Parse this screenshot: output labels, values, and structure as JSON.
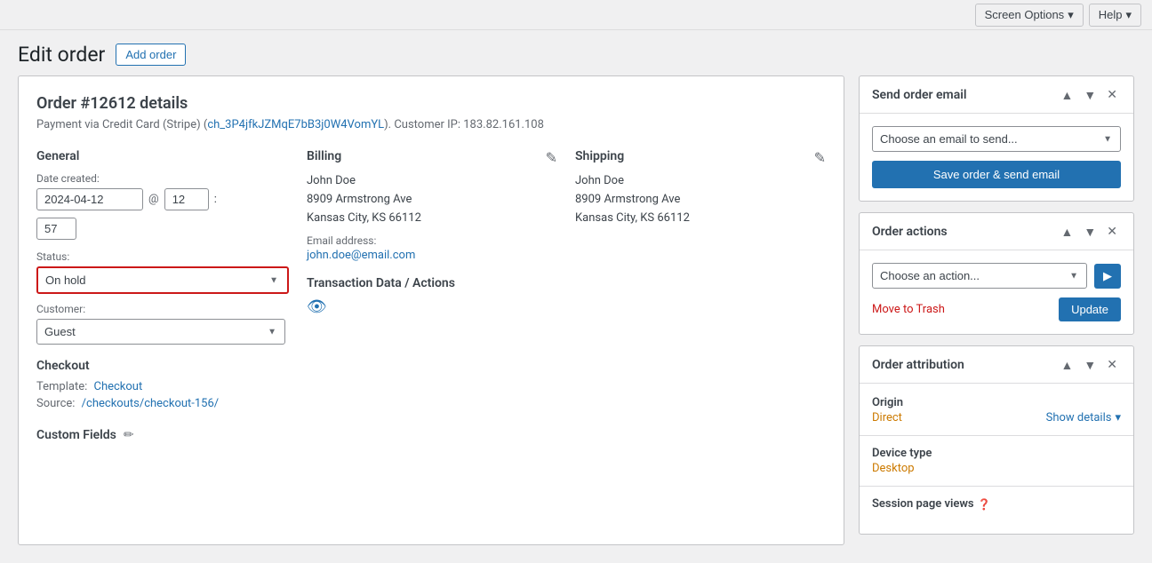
{
  "topbar": {
    "screen_options_label": "Screen Options",
    "help_label": "Help"
  },
  "header": {
    "page_title": "Edit order",
    "add_order_label": "Add order"
  },
  "order_details": {
    "title": "Order #12612 details",
    "subtitle_prefix": "Payment via Credit Card (Stripe) (",
    "subtitle_link_text": "ch_3P4jfkJZMqE7bB3j0W4VomYL",
    "subtitle_suffix": "). Customer IP: 183.82.161.108",
    "general": {
      "title": "General",
      "date_label": "Date created:",
      "date_value": "2024-04-12",
      "at_symbol": "@",
      "hour_value": "12",
      "colon": ":",
      "minute_value": "57",
      "status_label": "Status:",
      "status_value": "On hold",
      "customer_label": "Customer:",
      "customer_value": "Guest"
    },
    "checkout": {
      "title": "Checkout",
      "template_label": "Template:",
      "template_link_text": "Checkout",
      "source_label": "Source:",
      "source_link_text": "/checkouts/checkout-156/"
    },
    "custom_fields": {
      "title": "Custom Fields"
    },
    "billing": {
      "title": "Billing",
      "name": "John Doe",
      "address1": "8909 Armstrong Ave",
      "address2": "Kansas City, KS 66112",
      "email_label": "Email address:",
      "email": "john.doe@email.com"
    },
    "shipping": {
      "title": "Shipping",
      "name": "John Doe",
      "address1": "8909 Armstrong Ave",
      "address2": "Kansas City, KS 66112"
    },
    "transaction": {
      "title": "Transaction Data / Actions"
    }
  },
  "sidebar": {
    "send_email": {
      "title": "Send order email",
      "dropdown_placeholder": "Choose an email to send...",
      "save_btn_label": "Save order & send email"
    },
    "order_actions": {
      "title": "Order actions",
      "dropdown_placeholder": "Choose an action...",
      "go_btn_label": "▶",
      "move_trash_label": "Move to Trash",
      "update_btn_label": "Update"
    },
    "order_attribution": {
      "title": "Order attribution",
      "origin_key": "Origin",
      "origin_value": "Direct",
      "show_details_label": "Show details",
      "device_key": "Device type",
      "device_value": "Desktop",
      "session_key": "Session page views"
    }
  }
}
